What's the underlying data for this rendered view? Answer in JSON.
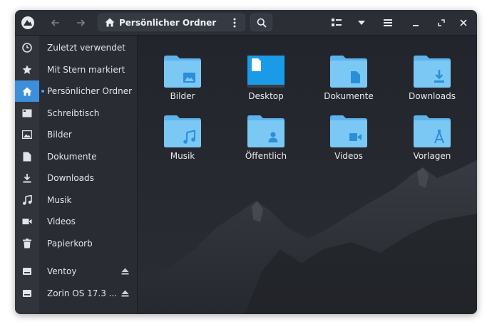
{
  "window": {
    "path_title": "Persönlicher Ordner"
  },
  "headerbar": {
    "icons": [
      "zorin-logo-icon",
      "back-arrow-icon",
      "forward-arrow-icon",
      "home-icon",
      "kebab-menu-icon",
      "search-icon",
      "list-view-icon",
      "chevron-down-icon",
      "hamburger-menu-icon",
      "minimize-icon",
      "maximize-icon",
      "close-icon"
    ]
  },
  "sidebar": {
    "items": [
      {
        "label": "Zuletzt verwendet",
        "icon": "clock-icon"
      },
      {
        "label": "Mit Stern markiert",
        "icon": "star-icon"
      },
      {
        "label": "Persönlicher Ordner",
        "icon": "home-icon"
      },
      {
        "label": "Schreibtisch",
        "icon": "desktop-icon"
      },
      {
        "label": "Bilder",
        "icon": "image-icon"
      },
      {
        "label": "Dokumente",
        "icon": "document-icon"
      },
      {
        "label": "Downloads",
        "icon": "download-icon"
      },
      {
        "label": "Musik",
        "icon": "music-icon"
      },
      {
        "label": "Videos",
        "icon": "video-icon"
      },
      {
        "label": "Papierkorb",
        "icon": "trash-icon"
      }
    ],
    "devices": [
      {
        "label": "Ventoy",
        "icon": "drive-icon"
      },
      {
        "label": "Zorin OS 17.3 ...",
        "icon": "drive-icon"
      }
    ]
  },
  "folders": [
    {
      "label": "Bilder",
      "emblem": "image"
    },
    {
      "label": "Desktop",
      "emblem": "desktop"
    },
    {
      "label": "Dokumente",
      "emblem": "document"
    },
    {
      "label": "Downloads",
      "emblem": "download"
    },
    {
      "label": "Musik",
      "emblem": "music"
    },
    {
      "label": "Öffentlich",
      "emblem": "person"
    },
    {
      "label": "Videos",
      "emblem": "video"
    },
    {
      "label": "Vorlagen",
      "emblem": "template"
    }
  ],
  "colors": {
    "accent": "#3d8fd9",
    "folder": "#7cc8f5",
    "folder_tab": "#5fb3ec",
    "emblem": "#2a8fd9"
  }
}
